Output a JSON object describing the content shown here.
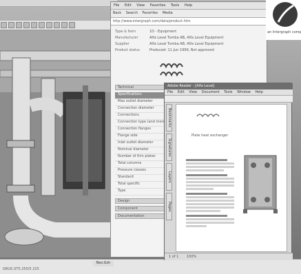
{
  "cad": {
    "status_label": "Nav.Gsh",
    "status_line": "GRUS UTS 255/5 225"
  },
  "datawin": {
    "menu": [
      "File",
      "Edit",
      "View",
      "Favorites",
      "Tools",
      "Help"
    ],
    "toolbar": [
      "Back",
      "Search",
      "Favorites",
      "Media"
    ],
    "address": "http://www.intergraph.com/data/product.htm",
    "fields": [
      {
        "key": "Type & Item",
        "value": "1D - Equipment"
      },
      {
        "key": "Manufacturer",
        "value": "Alfa Laval Tumba AB, Alfa Laval Equipment"
      },
      {
        "key": "Supplier",
        "value": "Alfa Laval Tumba AB, Alfa Laval Equipment"
      },
      {
        "key": "Product status",
        "value": "Produced: 11 Jun 1999, Not approved"
      }
    ],
    "logo_text": "ALFA LAVAL",
    "sidebar_header": "Technical",
    "sidebar_items": [
      "Specifications",
      "Max outlet diameter",
      "Connection diameter",
      "Connections",
      "Connection type (and more)",
      "Connection flanges",
      "Flange side",
      "Inlet outlet diameter",
      "Nominal diameter",
      "Number of thin plates",
      "Total columns",
      "Pressure classes",
      "Standard",
      "Total specific",
      "Type"
    ],
    "sidebar_footers": [
      "Design",
      "Component",
      "Documentation"
    ]
  },
  "pdf": {
    "title": "Adobe Reader - [Alfa Laval]",
    "menu": [
      "File",
      "Edit",
      "View",
      "Document",
      "Tools",
      "Window",
      "Help"
    ],
    "tabs": [
      "Bookmarks",
      "Signatures",
      "Layers",
      "Pages"
    ],
    "page_logo": "ALFA LAVAL",
    "page_heading": "Plate heat exchanger",
    "nav": [
      "1 of 1",
      "100%"
    ]
  },
  "corner": {
    "caption": "an Intergraph company"
  }
}
